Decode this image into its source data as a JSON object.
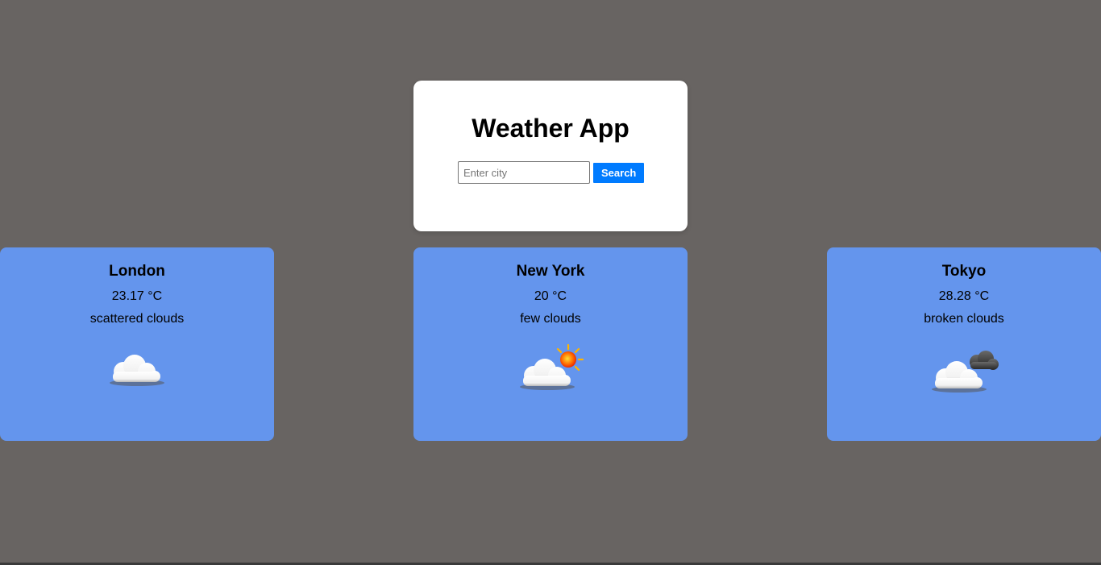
{
  "app": {
    "title": "Weather App"
  },
  "search": {
    "placeholder": "Enter city",
    "value": "",
    "button_label": "Search"
  },
  "cards": [
    {
      "city": "London",
      "temp": "23.17 °C",
      "description": "scattered clouds",
      "icon": "scattered-clouds-icon"
    },
    {
      "city": "New York",
      "temp": "20 °C",
      "description": "few clouds",
      "icon": "few-clouds-icon"
    },
    {
      "city": "Tokyo",
      "temp": "28.28 °C",
      "description": "broken clouds",
      "icon": "broken-clouds-icon"
    }
  ],
  "colors": {
    "background": "#686462",
    "card": "#6495ed",
    "button": "#007bff"
  }
}
